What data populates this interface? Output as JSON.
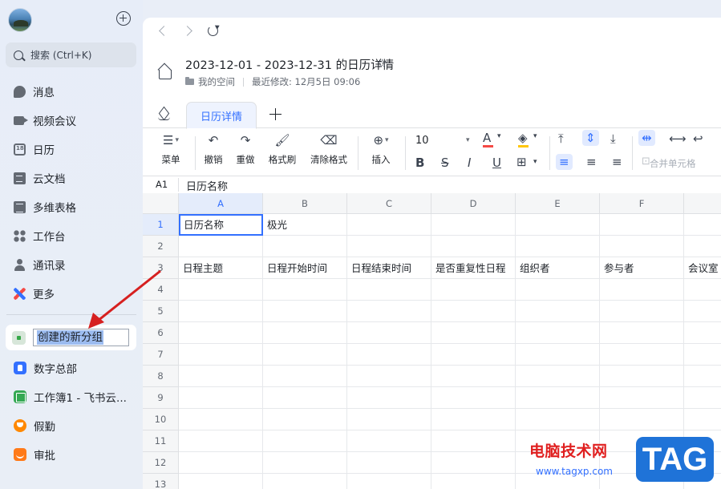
{
  "sidebar": {
    "search_placeholder": "搜索 (Ctrl+K)",
    "nav": [
      {
        "label": "消息"
      },
      {
        "label": "视频会议"
      },
      {
        "label": "日历"
      },
      {
        "label": "云文档"
      },
      {
        "label": "多维表格"
      },
      {
        "label": "工作台"
      },
      {
        "label": "通讯录"
      },
      {
        "label": "更多"
      }
    ],
    "new_group_value": "创建的新分组",
    "apps": [
      {
        "label": "数字总部"
      },
      {
        "label": "工作簿1 - 飞书云..."
      },
      {
        "label": "假勤"
      },
      {
        "label": "审批"
      }
    ]
  },
  "doc": {
    "title": "2023-12-01 - 2023-12-31 的日历详情",
    "space": "我的空间",
    "last_modified": "最近修改: 12月5日 09:06"
  },
  "tabs": {
    "active": "日历详情"
  },
  "toolbar": {
    "menu": "菜单",
    "undo": "撤销",
    "redo": "重做",
    "format_painter": "格式刷",
    "clear_format": "清除格式",
    "insert": "插入",
    "font_size": "10",
    "merge_cells": "合并单元格"
  },
  "formula_bar": {
    "cell_ref": "A1",
    "value": "日历名称"
  },
  "sheet": {
    "columns": [
      "A",
      "B",
      "C",
      "D",
      "E",
      "F",
      ""
    ],
    "rows": [
      "1",
      "2",
      "3",
      "4",
      "5",
      "6",
      "7",
      "8",
      "9",
      "10",
      "11",
      "12",
      "13"
    ],
    "row1": [
      "日历名称",
      "极光",
      "",
      "",
      "",
      "",
      ""
    ],
    "row3": [
      "日程主题",
      "日程开始时间",
      "日程结束时间",
      "是否重复性日程",
      "组织者",
      "参与者",
      "会议室"
    ]
  },
  "watermark": {
    "line1": "电脑技术网",
    "line2": "www.tagxp.com",
    "tag": "TAG"
  },
  "colors": {
    "accent": "#3370ff",
    "annotation_arrow": "#d62020"
  }
}
